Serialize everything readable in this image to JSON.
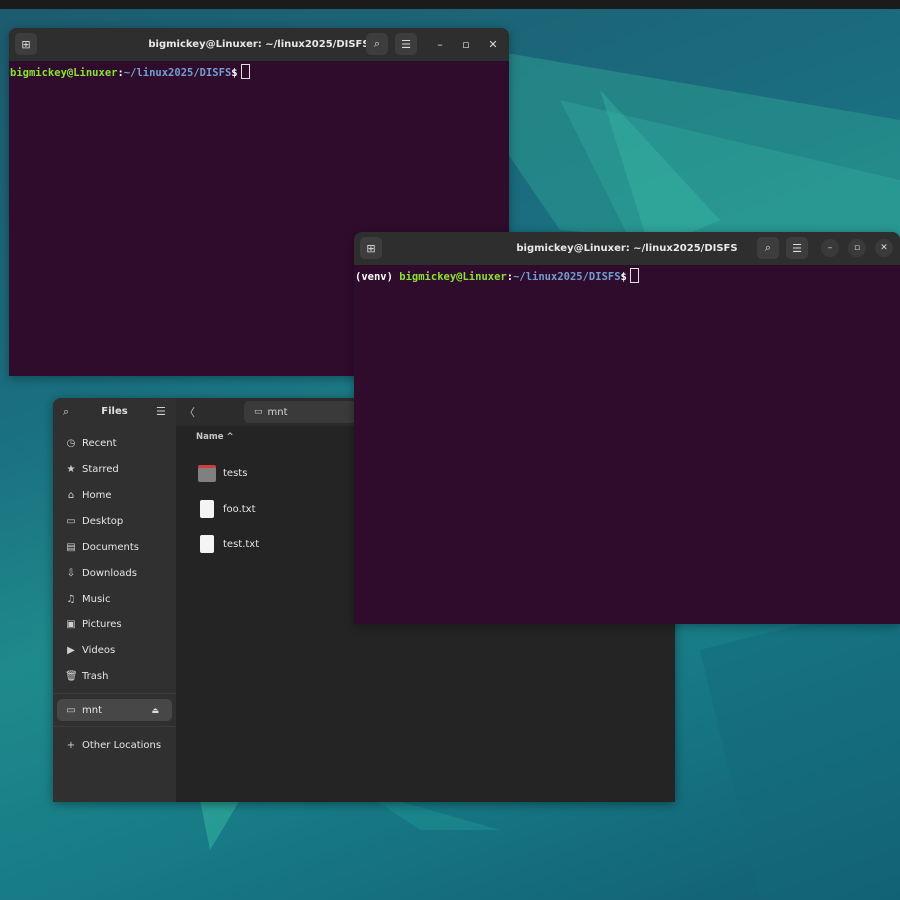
{
  "desktop": {
    "accent": "#1f8a8c"
  },
  "terminal1": {
    "title": "bigmickey@Linuxer: ~/linux2025/DISFS",
    "prompt_user": "bigmickey@Linuxer",
    "prompt_colon": ":",
    "prompt_path": "~/linux2025/DISFS",
    "prompt_end": "$",
    "bg_color": "#2f0c2c",
    "icons": {
      "new_tab": "new-tab-icon",
      "search": "search-icon",
      "menu": "hamburger-menu-icon",
      "minimize": "minimize-icon",
      "maximize": "maximize-icon",
      "close": "close-icon"
    }
  },
  "terminal2": {
    "title": "bigmickey@Linuxer: ~/linux2025/DISFS",
    "prompt_prefix": "(venv) ",
    "prompt_user": "bigmickey@Linuxer",
    "prompt_colon": ":",
    "prompt_path": "~/linux2025/DISFS",
    "prompt_end": "$"
  },
  "files": {
    "title": "Files",
    "path": "mnt",
    "column_header": "Name",
    "sidebar": {
      "items": [
        {
          "label": "Recent",
          "icon": "clock-icon"
        },
        {
          "label": "Starred",
          "icon": "star-icon"
        },
        {
          "label": "Home",
          "icon": "home-icon"
        },
        {
          "label": "Desktop",
          "icon": "desktop-icon"
        },
        {
          "label": "Documents",
          "icon": "documents-icon"
        },
        {
          "label": "Downloads",
          "icon": "downloads-icon"
        },
        {
          "label": "Music",
          "icon": "music-icon"
        },
        {
          "label": "Pictures",
          "icon": "pictures-icon"
        },
        {
          "label": "Videos",
          "icon": "videos-icon"
        },
        {
          "label": "Trash",
          "icon": "trash-icon"
        }
      ],
      "mounts": [
        {
          "label": "mnt",
          "icon": "drive-icon",
          "active": true
        }
      ],
      "other_locations": "Other Locations"
    },
    "entries": [
      {
        "name": "tests",
        "type": "folder"
      },
      {
        "name": "foo.txt",
        "type": "file"
      },
      {
        "name": "test.txt",
        "type": "file"
      }
    ]
  }
}
